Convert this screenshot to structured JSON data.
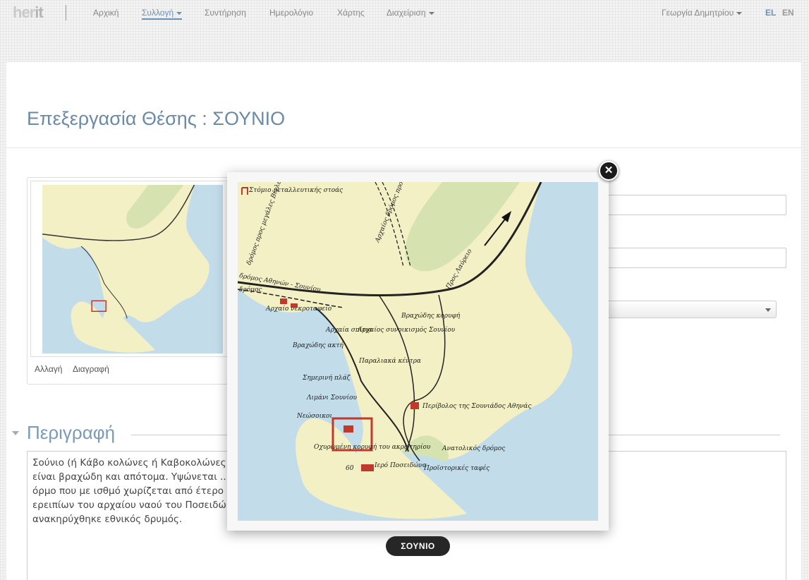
{
  "app": {
    "logo_main": "her",
    "logo_accent": "it"
  },
  "nav": {
    "items": [
      {
        "label": "Αρχική"
      },
      {
        "label": "Συλλογή"
      },
      {
        "label": "Συντήρηση"
      },
      {
        "label": "Ημερολόγιο"
      },
      {
        "label": "Χάρτης"
      },
      {
        "label": "Διαχείριση"
      }
    ],
    "user": "Γεωργία Δημητρίου",
    "lang_el": "EL",
    "lang_en": "EN"
  },
  "page": {
    "title": "Επεξεργασία Θέσης : ΣΟΥΝΙΟ"
  },
  "image_card": {
    "change_label": "Αλλαγή",
    "delete_label": "Διαγραφή"
  },
  "section": {
    "title": "Περιγραφή",
    "description": "Σούνιο (ή Κάβο κολώνες ή Καβοκολώνες) ... του νομού Αττικής. Τα παράλια του\nείναι βραχώδη και απότομα. Υψώνεται ... ώδες αυτού προς δυσμάς μικρό\nόρμο που με ισθμό χωρίζεται από έτερο ... ής θέσης του αλλά και εξαιτίας των\nερειπίων του αρχαίου ναού του Ποσειδώ ... ής περιβαλλοντικής αξίας της,\nανακηρύχθηκε εθνικός δρυμός."
  },
  "modal": {
    "caption": "ΣΟΥΝΙΟ",
    "close_symbol": "✕"
  },
  "map": {
    "labels": [
      "Στόμιο μεταλλευτικής στοάς",
      "Αρχαίος δρόμος προς την περιοχή Αγριλέζας",
      "δρόμος προς μεγάλες Βίγλες",
      "δρόμος Αθηνών - Σουνίου",
      "δρόμος",
      "Αρχαίο νεκροταφείο",
      "Προς Λαύρειο",
      "Βραχώδης κορυφή",
      "Αρχαία σπίτια",
      "Αρχαίος συνοικισμός Σουνίου",
      "Βραχώδης ακτή",
      "Παραλιακά κέντρα",
      "Σημερινή πλάζ",
      "Λιμάνι Σουνίου",
      "Περίβολος της Σουνιάδος Αθηνάς",
      "Νεώσοικοι",
      "Ανατολικός δρόμος",
      "Οχυρωμένη κορυφή του ακρωτηρίου",
      "Ιερό Ποσειδώνα",
      "Προϊστορικές ταφές",
      "60"
    ]
  },
  "colors": {
    "sea": "#c2dcea",
    "land": "#f4f0c5",
    "hills": "#d6e3b0",
    "accent": "#6b93b8"
  }
}
